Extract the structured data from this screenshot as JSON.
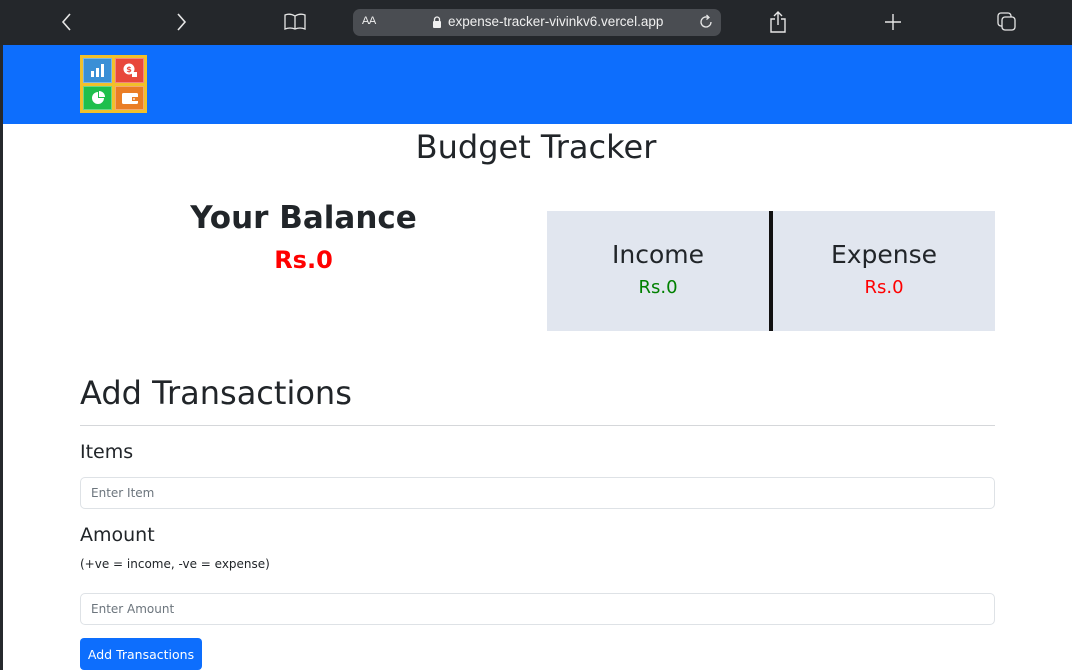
{
  "browser": {
    "url_text_size_label": "AA",
    "url": "expense-tracker-vivinkv6.vercel.app",
    "icons": {
      "back": "chevron-left-icon",
      "forward": "chevron-right-icon",
      "bookmarks": "book-icon",
      "lock": "lock-icon",
      "reload": "reload-icon",
      "share": "share-icon",
      "new_tab": "plus-icon",
      "tabs": "tabs-icon"
    }
  },
  "navbar": {
    "logo": "budget-app-logo",
    "brand_color": "#0d6efd",
    "logo_tiles": [
      {
        "icon": "bar-chart-icon",
        "color": "#3a8fd6"
      },
      {
        "icon": "money-bag-icon",
        "color": "#e8483b"
      },
      {
        "icon": "pie-chart-icon",
        "color": "#1fbf4c"
      },
      {
        "icon": "wallet-icon",
        "color": "#ea7d25"
      }
    ]
  },
  "main": {
    "title": "Budget Tracker",
    "balance": {
      "label": "Your Balance",
      "value": "Rs.0",
      "color": "#ff0000"
    },
    "summary": {
      "income": {
        "label": "Income",
        "value": "Rs.0",
        "color": "#008000"
      },
      "expense": {
        "label": "Expense",
        "value": "Rs.0",
        "color": "#ff0000"
      }
    },
    "form": {
      "title": "Add Transactions",
      "item_label": "Items",
      "item_value": "",
      "item_placeholder": "Enter Item",
      "amount_label": "Amount",
      "amount_hint": "(+ve = income, -ve = expense)",
      "amount_value": "",
      "amount_placeholder": "Enter Amount",
      "submit_label": "Add Transactions"
    }
  }
}
